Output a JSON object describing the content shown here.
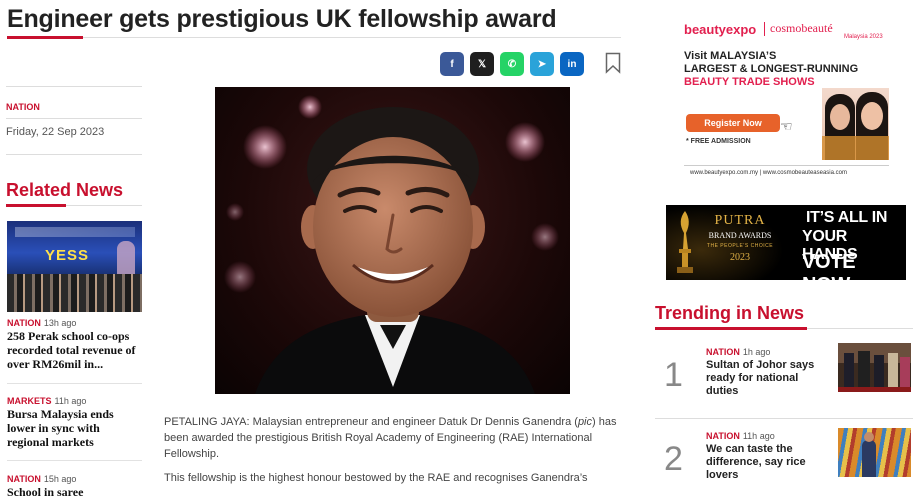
{
  "article": {
    "headline": "Engineer gets prestigious UK fellowship award",
    "category": "NATION",
    "date": "Friday, 22 Sep 2023",
    "paragraph1_a": "PETALING JAYA: Malaysian entrepreneur and engineer Datuk Dr Dennis Ganendra (",
    "paragraph1_pic": "pic",
    "paragraph1_b": ") has been awarded the prestigious British Royal Academy of Engineering (RAE) International Fellowship.",
    "paragraph2": "This fellowship is the highest honour bestowed by the RAE and recognises Ganendra’s"
  },
  "share": {
    "facebook": "f",
    "x": "𝕏",
    "whatsapp": "✆",
    "telegram": "➤",
    "linkedin": "in"
  },
  "related": {
    "title": "Related News",
    "thumb_text": "YESS",
    "items": [
      {
        "category": "NATION",
        "ago": "13h ago",
        "title": "258 Perak school co-ops recorded total revenue of over RM26mil in..."
      },
      {
        "category": "MARKETS",
        "ago": "11h ago",
        "title": "Bursa Malaysia ends lower in sync with regional markets"
      },
      {
        "category": "NATION",
        "ago": "15h ago",
        "title": "School in saree"
      }
    ]
  },
  "ads": {
    "ad1": {
      "brand_left": "beautyexpo",
      "brand_right": "cosmobeauté",
      "brand_right_sub": "Malaysia 2023",
      "line1": "Visit MALAYSIA’S",
      "line2": "LARGEST & LONGEST-RUNNING",
      "line3": "BEAUTY TRADE SHOWS",
      "button": "Register Now",
      "free": "* FREE ADMISSION",
      "footer": "www.beautyexpo.com.my | www.cosmobeautease​asia.com"
    },
    "ad2": {
      "brand": "PUTRA",
      "sub1": "BRAND AWARDS",
      "sub2": "THE PEOPLE’S CHOICE",
      "year": "2023",
      "slogan1": "IT’S ALL IN",
      "slogan2": "YOUR HANDS",
      "slogan3": "VOTE NOW"
    }
  },
  "trending": {
    "title": "Trending in News",
    "items": [
      {
        "rank": "1",
        "category": "NATION",
        "ago": "1h ago",
        "title": "Sultan of Johor says ready for national duties"
      },
      {
        "rank": "2",
        "category": "NATION",
        "ago": "11h ago",
        "title": "We can taste the difference, say rice lovers"
      }
    ]
  },
  "colors": {
    "brand_red": "#c8102e",
    "facebook": "#3b5998",
    "x": "#1f1f1f",
    "whatsapp": "#25d366",
    "telegram": "#2aa3d9",
    "linkedin": "#0a66c2"
  }
}
